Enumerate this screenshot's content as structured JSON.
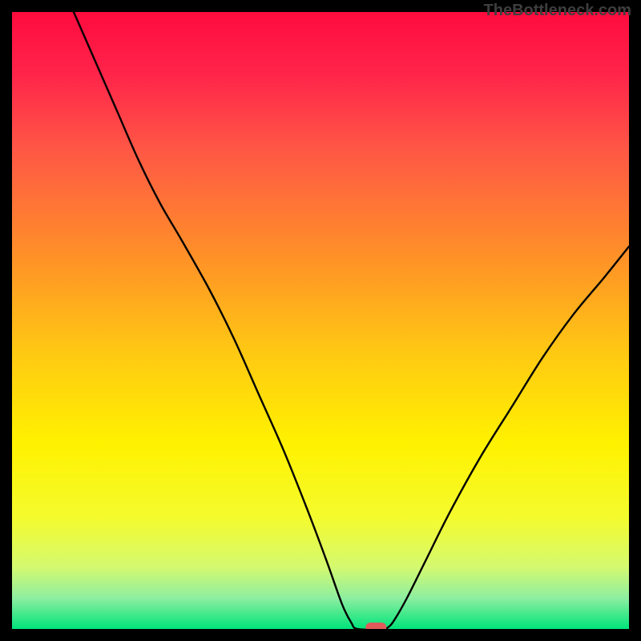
{
  "watermark": {
    "text": "TheBottleneck.com"
  },
  "chart_data": {
    "type": "line",
    "title": "",
    "xlabel": "",
    "ylabel": "",
    "x_range": [
      0,
      100
    ],
    "y_range": [
      0,
      100
    ],
    "curve": [
      {
        "x": 10.0,
        "y": 100.0
      },
      {
        "x": 13.5,
        "y": 92.0
      },
      {
        "x": 17.0,
        "y": 84.0
      },
      {
        "x": 20.5,
        "y": 76.0
      },
      {
        "x": 24.0,
        "y": 69.0
      },
      {
        "x": 27.5,
        "y": 63.0
      },
      {
        "x": 32.0,
        "y": 55.0
      },
      {
        "x": 36.0,
        "y": 47.0
      },
      {
        "x": 40.0,
        "y": 38.0
      },
      {
        "x": 44.0,
        "y": 29.0
      },
      {
        "x": 48.0,
        "y": 19.0
      },
      {
        "x": 51.0,
        "y": 11.0
      },
      {
        "x": 53.5,
        "y": 4.0
      },
      {
        "x": 55.0,
        "y": 1.0
      },
      {
        "x": 56.0,
        "y": 0.0
      },
      {
        "x": 60.0,
        "y": 0.0
      },
      {
        "x": 61.0,
        "y": 0.3
      },
      {
        "x": 62.0,
        "y": 1.5
      },
      {
        "x": 64.0,
        "y": 5.0
      },
      {
        "x": 67.0,
        "y": 11.0
      },
      {
        "x": 71.0,
        "y": 19.0
      },
      {
        "x": 76.0,
        "y": 28.0
      },
      {
        "x": 81.0,
        "y": 36.0
      },
      {
        "x": 86.0,
        "y": 44.0
      },
      {
        "x": 91.0,
        "y": 51.0
      },
      {
        "x": 96.0,
        "y": 57.0
      },
      {
        "x": 100.0,
        "y": 62.0
      }
    ],
    "marker": {
      "x": 59.0,
      "y": 0.0,
      "color": "#e05a5a"
    },
    "gradient_stops": [
      {
        "offset": 0.0,
        "color": "#ff0b3e"
      },
      {
        "offset": 0.1,
        "color": "#ff244a"
      },
      {
        "offset": 0.22,
        "color": "#ff5646"
      },
      {
        "offset": 0.4,
        "color": "#ff9227"
      },
      {
        "offset": 0.55,
        "color": "#ffc813"
      },
      {
        "offset": 0.7,
        "color": "#fff200"
      },
      {
        "offset": 0.82,
        "color": "#f4fb2e"
      },
      {
        "offset": 0.9,
        "color": "#d4f970"
      },
      {
        "offset": 0.95,
        "color": "#8deea0"
      },
      {
        "offset": 1.0,
        "color": "#00e47a"
      }
    ]
  }
}
